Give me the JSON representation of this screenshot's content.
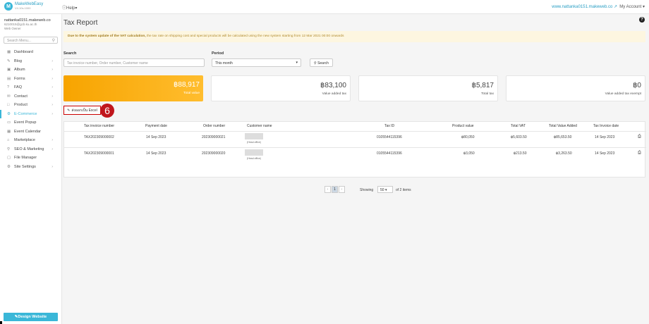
{
  "brand": {
    "name": "MakeWebEasy",
    "version": "V4.10s.1000"
  },
  "topbar": {
    "help": "Help",
    "site": "www.nattanka0151.makeweb.co",
    "account": "My Account"
  },
  "user": {
    "email": "nattanka0151.makeweb.co",
    "email2": "6210015@gcb.ku.ac.th",
    "role": "Web Owner"
  },
  "sidebar": {
    "search_placeholder": "Search Menu...",
    "items": [
      {
        "label": "Dashboard",
        "icon": "dashboard-icon",
        "glyph": "▦",
        "arrow": false
      },
      {
        "label": "Blog",
        "icon": "blog-icon",
        "glyph": "✎",
        "arrow": true
      },
      {
        "label": "Album",
        "icon": "album-icon",
        "glyph": "▣",
        "arrow": true
      },
      {
        "label": "Forms",
        "icon": "forms-icon",
        "glyph": "▤",
        "arrow": true
      },
      {
        "label": "FAQ",
        "icon": "faq-icon",
        "glyph": "?",
        "arrow": true
      },
      {
        "label": "Contact",
        "icon": "contact-icon",
        "glyph": "✉",
        "arrow": true
      },
      {
        "label": "Product",
        "icon": "product-icon",
        "glyph": "□",
        "arrow": true
      },
      {
        "label": "E-Commerce",
        "icon": "ecommerce-icon",
        "glyph": "⚙",
        "arrow": true,
        "active": true
      },
      {
        "label": "Event Popup",
        "icon": "popup-icon",
        "glyph": "▭",
        "arrow": false
      },
      {
        "label": "Event Calendar",
        "icon": "calendar-icon",
        "glyph": "▦",
        "arrow": false
      },
      {
        "label": "Marketplace",
        "icon": "marketplace-icon",
        "glyph": "⌂",
        "arrow": true
      },
      {
        "label": "SEO & Marketing",
        "icon": "seo-icon",
        "glyph": "⚲",
        "arrow": true
      },
      {
        "label": "File Manager",
        "icon": "file-icon",
        "glyph": "▢",
        "arrow": false
      },
      {
        "label": "Site Settings",
        "icon": "settings-icon",
        "glyph": "⚙",
        "arrow": true
      }
    ],
    "design_button": "Design Website"
  },
  "page": {
    "title": "Tax Report",
    "notice_bold": "Due to the system update of the VAT calculation,",
    "notice_rest": " the tax rate on shipping cost and special products will be calculated using the new system starting from 12 Mar 2021 00:00 onwards",
    "search_label": "Search",
    "search_placeholder": "Tax invoice number, Order number, Customer name",
    "period_label": "Period",
    "period_value": "This month",
    "search_button": "Search",
    "export_label": "ส่งออกเป็น Excel",
    "step": "6"
  },
  "cards": [
    {
      "value": "฿88,917",
      "label": "Total value"
    },
    {
      "value": "฿83,100",
      "label": "Value added tax"
    },
    {
      "value": "฿5,817",
      "label": "Total tax"
    },
    {
      "value": "฿0",
      "label": "Value added tax exempt"
    }
  ],
  "table": {
    "headers": [
      "Tax invoice number",
      "Payment date",
      "Order number",
      "Customer name",
      "Tax ID",
      "Product value",
      "Total VAT",
      "Total Value Added",
      "Tax Invoice date"
    ],
    "rows": [
      {
        "invoice": "TAX202309000002",
        "payment": "14 Sep 2023",
        "order": "202309000021",
        "branch": "(Head office)",
        "taxid": "0105544115396",
        "product": "฿80,050",
        "vat": "฿5,603.50",
        "added": "฿85,653.50",
        "date": "14 Sep 2023"
      },
      {
        "invoice": "TAX202309000001",
        "payment": "14 Sep 2023",
        "order": "202309000020",
        "branch": "(Head office)",
        "taxid": "0105544115396",
        "product": "฿3,050",
        "vat": "฿213.50",
        "added": "฿3,263.50",
        "date": "14 Sep 2023"
      }
    ]
  },
  "pagination": {
    "prev": "‹",
    "page": "1",
    "next": "›",
    "showing": "Showing",
    "per_page": "50",
    "of": "of 2 items"
  }
}
